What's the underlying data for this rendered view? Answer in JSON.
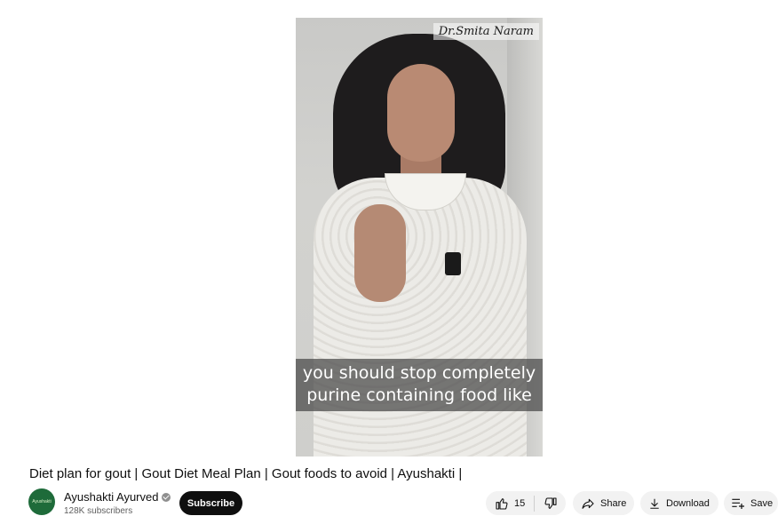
{
  "video": {
    "watermark": "Dr.Smita Naram",
    "caption_lines": [
      "you should stop completely",
      "purine containing food like"
    ]
  },
  "title": "Diet plan for gout | Gout Diet Meal Plan | Gout foods to avoid | Ayushakti |",
  "channel": {
    "name": "Ayushakti Ayurved",
    "subscribers": "128K subscribers",
    "avatar_text": "Ayushakti",
    "subscribe_label": "Subscribe"
  },
  "actions": {
    "like_count": "15",
    "share_label": "Share",
    "download_label": "Download",
    "save_label": "Save"
  },
  "colors": {
    "subscribe_bg": "#0f0f0f",
    "pill_bg": "#f2f2f2",
    "avatar_bg": "#1e6b3a"
  }
}
